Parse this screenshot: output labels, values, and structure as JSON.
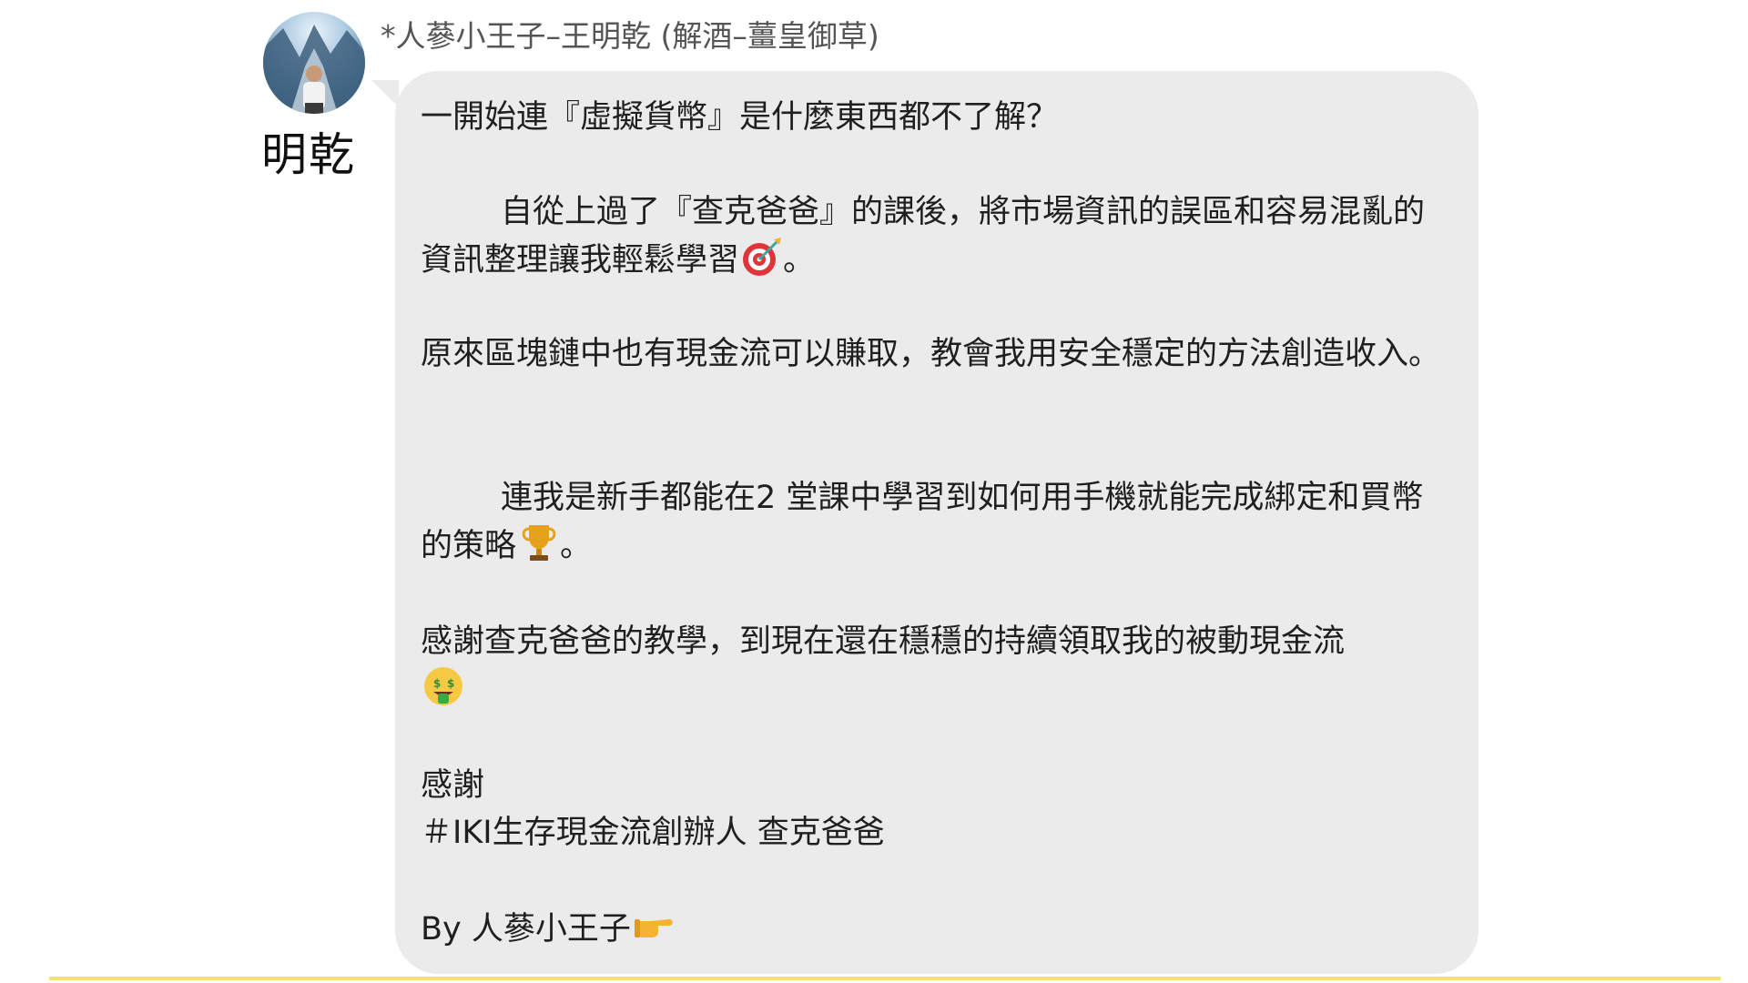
{
  "sender": {
    "full_name": "*人蔘小王子–王明乾 (解酒–薑皇御草)",
    "short_name": "明乾",
    "avatar_icon": "avatar-photo"
  },
  "message": {
    "p1": "一開始連『虛擬貨幣』是什麼東西都不了解？",
    "p2": "自從上過了『查克爸爸』的課後，將市場資訊的誤區和容易混亂的資訊整理讓我輕鬆學習",
    "p2_end": "。",
    "p2_emoji": "direct-hit-icon",
    "p3": "原來區塊鏈中也有現金流可以賺取，教會我用安全穩定的方法創造收入。",
    "p4": "連我是新手都能在2 堂課中學習到如何用手機就能完成綁定和買幣的策略",
    "p4_end": "。",
    "p4_emoji": "trophy-icon",
    "p5": "感謝查克爸爸的教學，到現在還在穩穩的持續領取我的被動現金流",
    "p5_emoji": "money-mouth-face-icon",
    "p6_line1": "感謝",
    "p6_line2": "＃IKI生存現金流創辦人 查克爸爸",
    "p7": "By 人蔘小王子",
    "p7_emoji": "pointing-right-icon"
  },
  "colors": {
    "bubble": "#ebebeb",
    "accent_line": "#f7e36a",
    "text": "#1f1f1f",
    "header_text": "#555555"
  }
}
